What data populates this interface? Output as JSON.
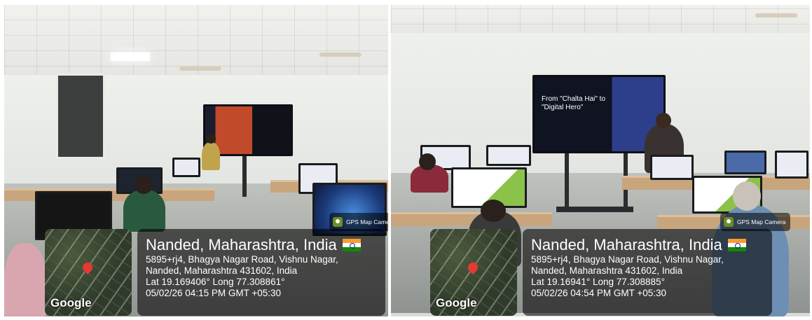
{
  "photos": [
    {
      "slide_text": "",
      "badge": "GPS Map Camera",
      "map_logo": "Google",
      "location_title": "Nanded, Maharashtra, India",
      "address_line1": "5895+rj4, Bhagya Nagar Road, Vishnu Nagar,",
      "address_line2": "Nanded, Maharashtra 431602, India",
      "coords": "Lat 19.169406° Long 77.308861°",
      "timestamp": "05/02/26 04:15 PM GMT +05:30"
    },
    {
      "slide_text": "From \"Chalta Hai\" to \"Digital Hero\"",
      "badge": "GPS Map Camera",
      "map_logo": "Google",
      "location_title": "Nanded, Maharashtra, India",
      "address_line1": "5895+rj4, Bhagya Nagar Road, Vishnu Nagar,",
      "address_line2": "Nanded, Maharashtra 431602, India",
      "coords": "Lat 19.16941° Long 77.308885°",
      "timestamp": "05/02/26 04:54 PM GMT +05:30"
    }
  ],
  "icons": {
    "flag": "india-flag-icon",
    "pin": "map-pin-icon",
    "badge": "camera-icon"
  }
}
